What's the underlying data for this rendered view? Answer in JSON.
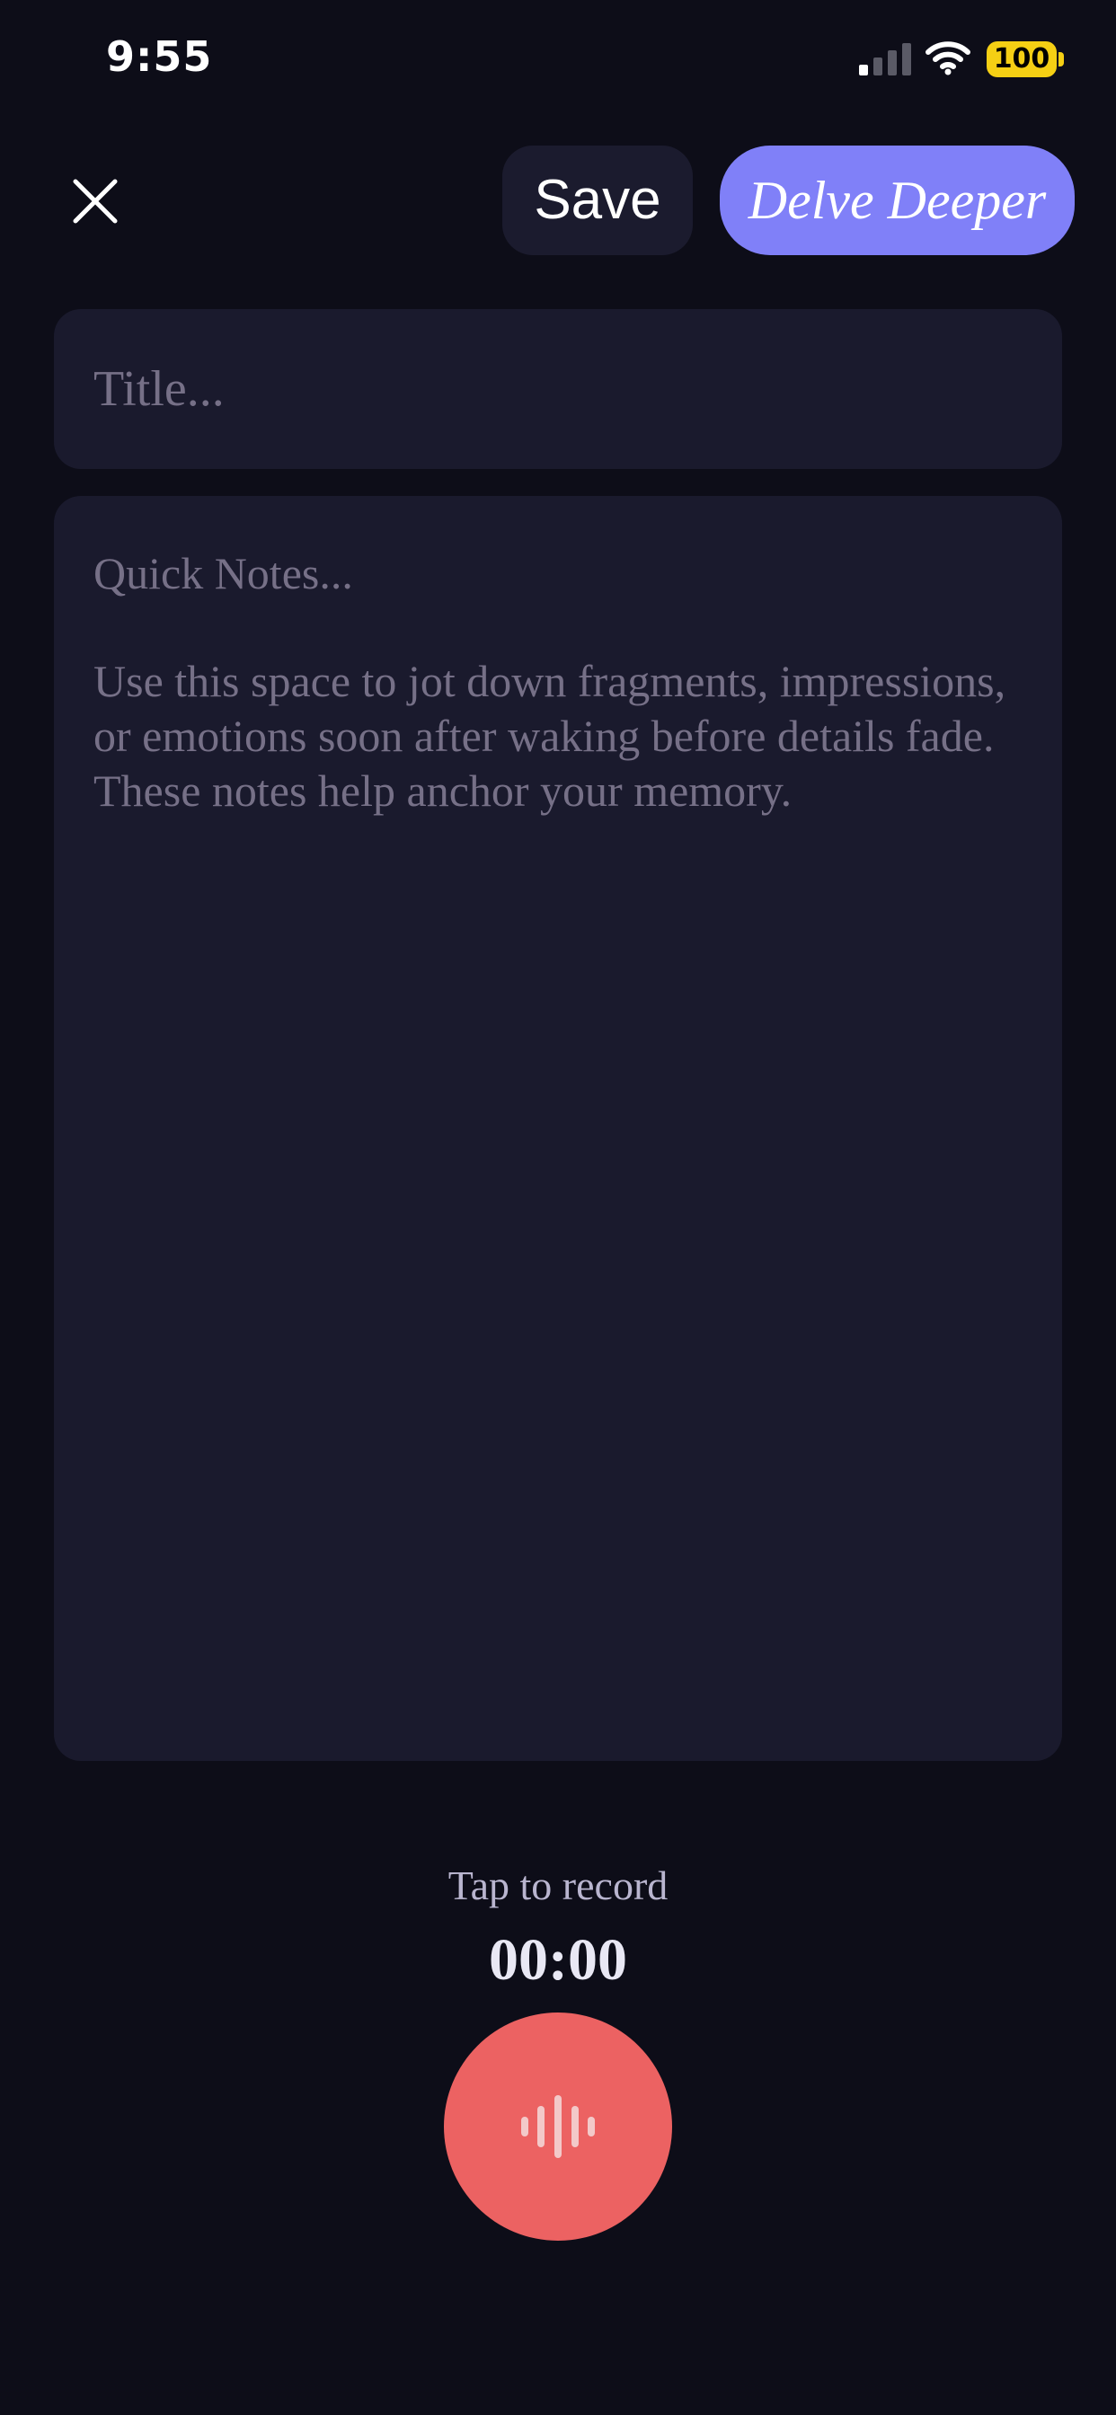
{
  "status_bar": {
    "time": "9:55",
    "battery": "100",
    "signal_icon": "cellular-signal-icon",
    "wifi_icon": "wifi-icon"
  },
  "header": {
    "close_icon": "close-icon",
    "save_label": "Save",
    "delve_label": "Delve Deeper"
  },
  "title_field": {
    "placeholder": "Title...",
    "value": ""
  },
  "notes_field": {
    "placeholder": "Quick Notes...",
    "hint": "Use this space to jot down fragments, impressions, or emotions soon after waking before details fade. These notes help anchor your memory."
  },
  "recorder": {
    "label": "Tap to record",
    "timer": "00:00",
    "icon": "audio-waveform-icon"
  },
  "colors": {
    "background": "#0d0d18",
    "card": "#1a1a2d",
    "accent": "#8080f8",
    "record": "#ec6262",
    "battery": "#f5cf14"
  }
}
